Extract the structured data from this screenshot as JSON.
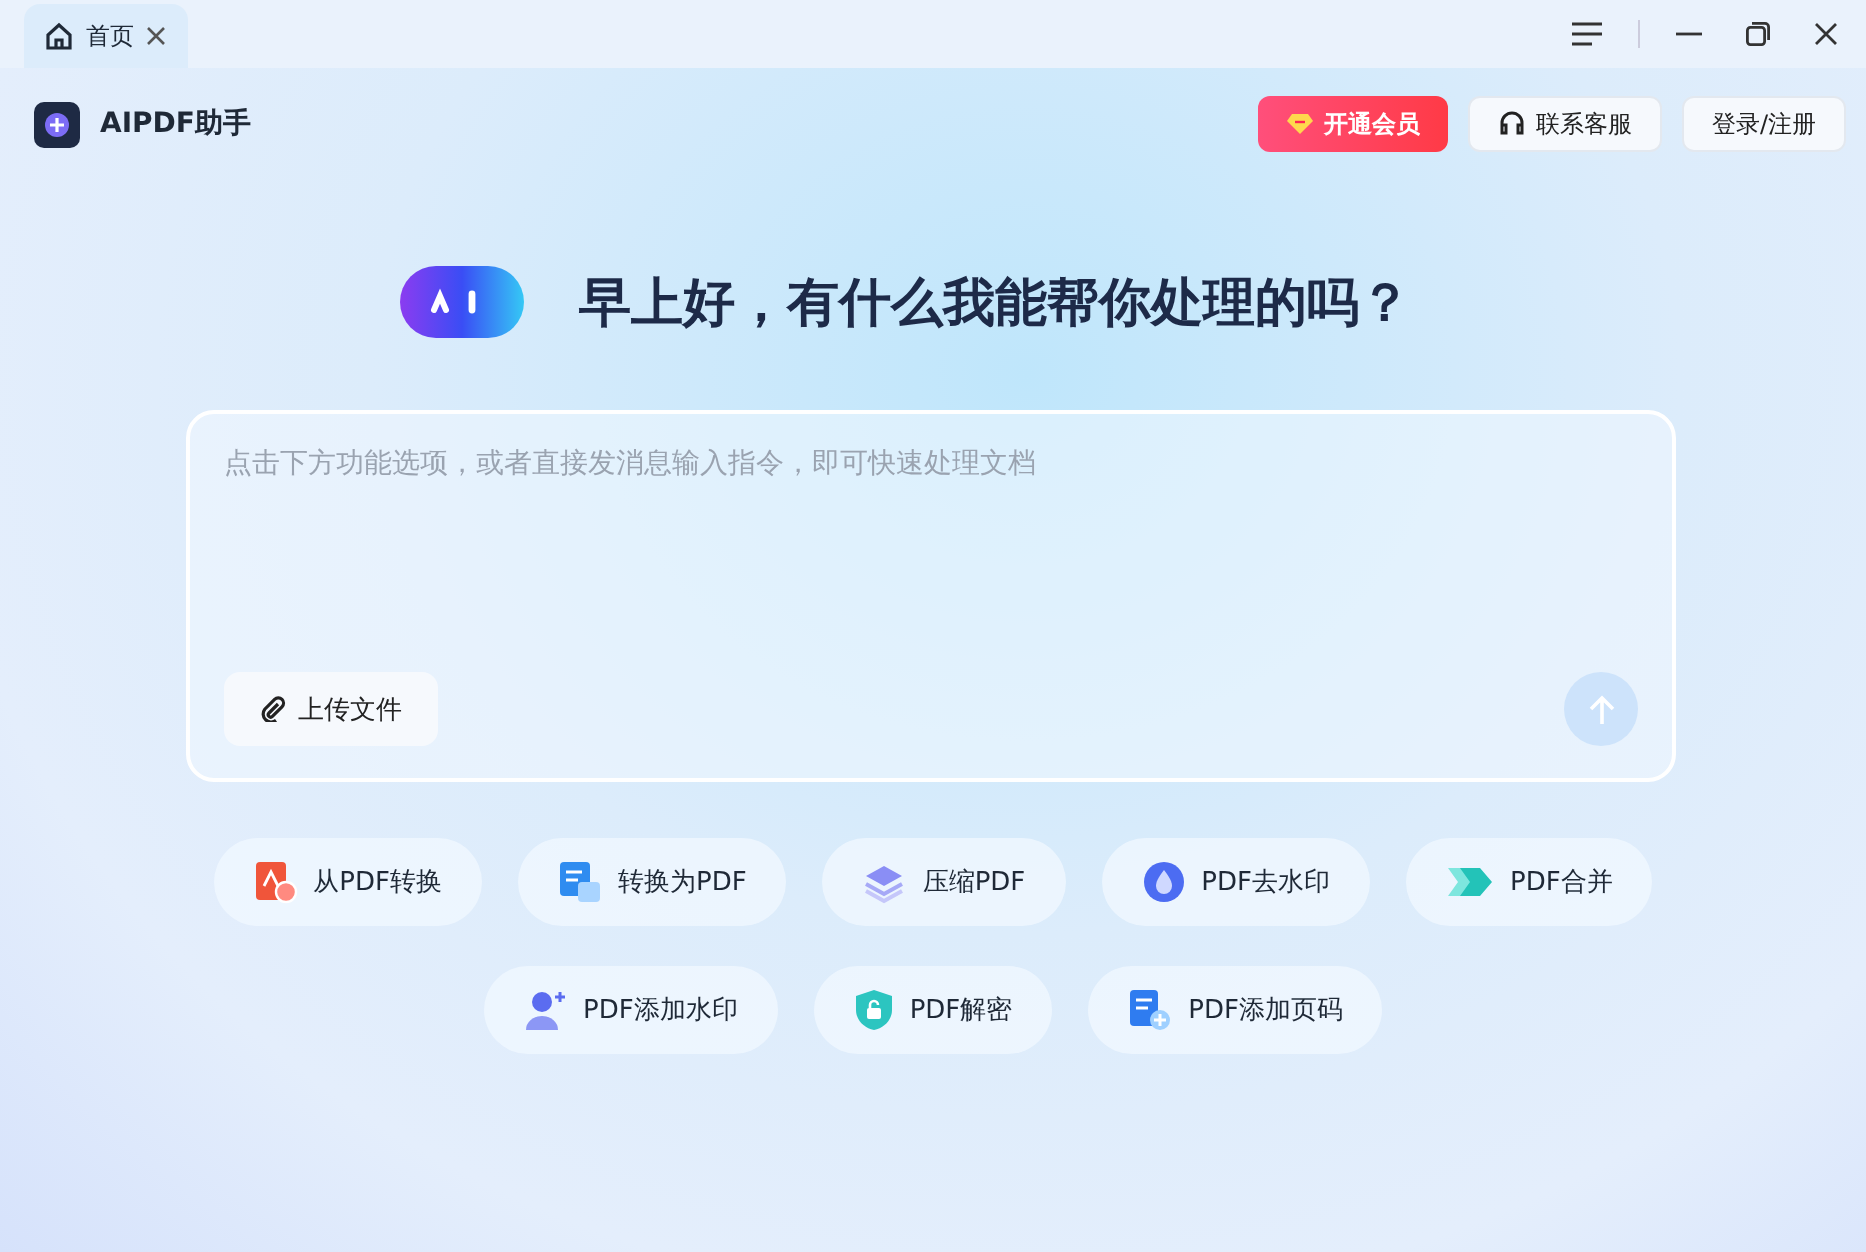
{
  "tabs": [
    {
      "label": "首页",
      "selected": true
    }
  ],
  "app": {
    "name": "AIPDF助手"
  },
  "header_buttons": [
    {
      "label": "开通会员",
      "kind": "vip"
    },
    {
      "label": "联系客服",
      "kind": "support"
    },
    {
      "label": "登录/注册",
      "kind": "plain"
    }
  ],
  "greeting": "早上好，有什么我能帮你处理的吗？",
  "prompt": {
    "placeholder": "点击下方功能选项，或者直接发消息输入指令，即可快速处理文档",
    "upload_label": "上传文件"
  },
  "tool_rows": [
    [
      {
        "label": "从PDF转换",
        "kind": "from-pdf"
      },
      {
        "label": "转换为PDF",
        "kind": "to-pdf"
      },
      {
        "label": "压缩PDF",
        "kind": "compress"
      },
      {
        "label": "PDF去水印",
        "kind": "remove-watermark"
      },
      {
        "label": "PDF合并",
        "kind": "merge"
      }
    ],
    [
      {
        "label": "PDF添加水印",
        "kind": "add-watermark"
      },
      {
        "label": "PDF解密",
        "kind": "decrypt"
      },
      {
        "label": "PDF添加页码",
        "kind": "page-number"
      }
    ]
  ]
}
